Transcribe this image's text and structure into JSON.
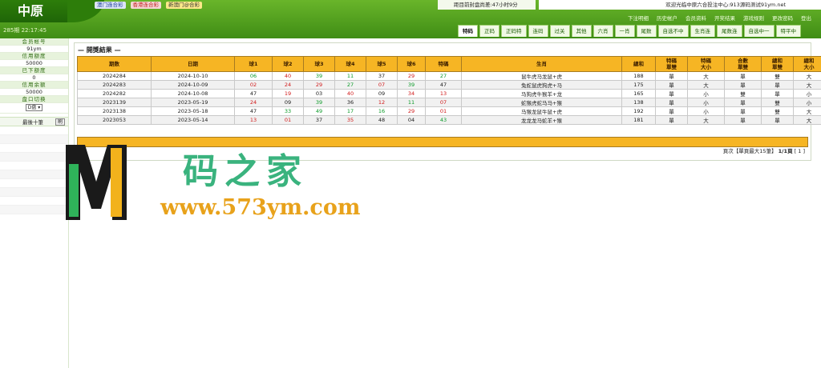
{
  "header": {
    "logo": "中原",
    "date_line": "285期 22:17:45",
    "lottery_tabs": [
      "澳门连合彩",
      "香港连合彩",
      "新澳门@合彩"
    ],
    "countdown": "距目前封盘尚差:47小时9分",
    "welcome": "欢迎光临中原六合投注中心:913源码测试91ym.net",
    "menu": [
      "下注明细",
      "历史帐户",
      "会员资料",
      "开奖结果",
      "游戏规则",
      "更改密码",
      "登出"
    ],
    "nav_tabs": [
      "特码",
      "正码",
      "正码特",
      "连码",
      "过关",
      "其他",
      "六肖",
      "一肖",
      "尾数",
      "自选不中",
      "生肖连",
      "尾数连",
      "自选中一",
      "特平中"
    ]
  },
  "sidebar": {
    "account_label": "会员帐号",
    "account_value": "91ym",
    "credit_label": "信用额度",
    "credit_value": "50000",
    "used_label": "已下额度",
    "used_value": "0",
    "balance_label": "信用余额",
    "balance_value": "50000",
    "switch_label": "盘口切换",
    "switch_value": "D盘",
    "recent_label": "最後十筆",
    "refresh_label": "刷"
  },
  "results": {
    "title": "— 開獎結果 —",
    "headers": [
      "期数",
      "日期",
      "球1",
      "球2",
      "球3",
      "球4",
      "球5",
      "球6",
      "特碼",
      "生肖",
      "總和",
      "特碼\n單雙",
      "特碼\n大小",
      "合數\n單雙",
      "總和\n單雙",
      "總和\n大小"
    ],
    "rows": [
      {
        "period": "2024284",
        "date": "2024-10-10",
        "balls": [
          {
            "n": "06",
            "c": "g"
          },
          {
            "n": "40",
            "c": "r"
          },
          {
            "n": "39",
            "c": "g"
          },
          {
            "n": "11",
            "c": "g"
          },
          {
            "n": "37",
            "c": "b"
          },
          {
            "n": "29",
            "c": "r"
          }
        ],
        "special": {
          "n": "27",
          "c": "g"
        },
        "zodiac": "鼠牛虎马龙鼠+虎",
        "sum": "188",
        "sp_oe": "單",
        "sp_bs": "大",
        "cmb_oe": "單",
        "sum_oe": "雙",
        "sum_bs": "大"
      },
      {
        "period": "2024283",
        "date": "2024-10-09",
        "balls": [
          {
            "n": "02",
            "c": "r"
          },
          {
            "n": "24",
            "c": "r"
          },
          {
            "n": "29",
            "c": "r"
          },
          {
            "n": "27",
            "c": "g"
          },
          {
            "n": "07",
            "c": "r"
          },
          {
            "n": "39",
            "c": "g"
          }
        ],
        "special": {
          "n": "47",
          "c": "b"
        },
        "zodiac": "兔蛇鼠虎狗虎+马",
        "sum": "175",
        "sp_oe": "單",
        "sp_bs": "大",
        "cmb_oe": "單",
        "sum_oe": "單",
        "sum_bs": "大"
      },
      {
        "period": "2024282",
        "date": "2024-10-08",
        "balls": [
          {
            "n": "47",
            "c": "b"
          },
          {
            "n": "19",
            "c": "r"
          },
          {
            "n": "03",
            "c": "b"
          },
          {
            "n": "40",
            "c": "r"
          },
          {
            "n": "09",
            "c": "b"
          },
          {
            "n": "34",
            "c": "r"
          }
        ],
        "special": {
          "n": "13",
          "c": "r"
        },
        "zodiac": "马狗虎牛猴羊+龙",
        "sum": "165",
        "sp_oe": "單",
        "sp_bs": "小",
        "cmb_oe": "雙",
        "sum_oe": "單",
        "sum_bs": "小"
      },
      {
        "period": "2023139",
        "date": "2023-05-19",
        "balls": [
          {
            "n": "24",
            "c": "r"
          },
          {
            "n": "09",
            "c": "b"
          },
          {
            "n": "39",
            "c": "g"
          },
          {
            "n": "36",
            "c": "b"
          },
          {
            "n": "12",
            "c": "r"
          },
          {
            "n": "11",
            "c": "g"
          }
        ],
        "special": {
          "n": "07",
          "c": "r"
        },
        "zodiac": "蛇猴虎蛇马马+猴",
        "sum": "138",
        "sp_oe": "單",
        "sp_bs": "小",
        "cmb_oe": "單",
        "sum_oe": "雙",
        "sum_bs": "小"
      },
      {
        "period": "2023138",
        "date": "2023-05-18",
        "balls": [
          {
            "n": "47",
            "c": "b"
          },
          {
            "n": "33",
            "c": "g"
          },
          {
            "n": "49",
            "c": "g"
          },
          {
            "n": "17",
            "c": "g"
          },
          {
            "n": "16",
            "c": "g"
          },
          {
            "n": "29",
            "c": "r"
          }
        ],
        "special": {
          "n": "01",
          "c": "r"
        },
        "zodiac": "马猴龙鼠牛鼠+虎",
        "sum": "192",
        "sp_oe": "單",
        "sp_bs": "小",
        "cmb_oe": "單",
        "sum_oe": "雙",
        "sum_bs": "大"
      },
      {
        "period": "2023053",
        "date": "2023-05-14",
        "balls": [
          {
            "n": "13",
            "c": "r"
          },
          {
            "n": "01",
            "c": "r"
          },
          {
            "n": "37",
            "c": "b"
          },
          {
            "n": "35",
            "c": "r"
          },
          {
            "n": "48",
            "c": "b"
          },
          {
            "n": "04",
            "c": "b"
          }
        ],
        "special": {
          "n": "43",
          "c": "g"
        },
        "zodiac": "龙龙龙马蛇羊+猴",
        "sum": "181",
        "sp_oe": "單",
        "sp_bs": "大",
        "cmb_oe": "單",
        "sum_oe": "單",
        "sum_bs": "大"
      }
    ],
    "pager_prefix": "頁次【單頁最大15筆】",
    "pager_pages": "1/1頁",
    "pager_links": "[ 1 ]"
  },
  "watermark": {
    "text": "码之家",
    "url": "www.573ym.com"
  },
  "colors": {
    "header_green": "#4a9a1a",
    "table_header": "#f6b524",
    "red_ball": "#d01818",
    "green_ball": "#0a9a27"
  }
}
